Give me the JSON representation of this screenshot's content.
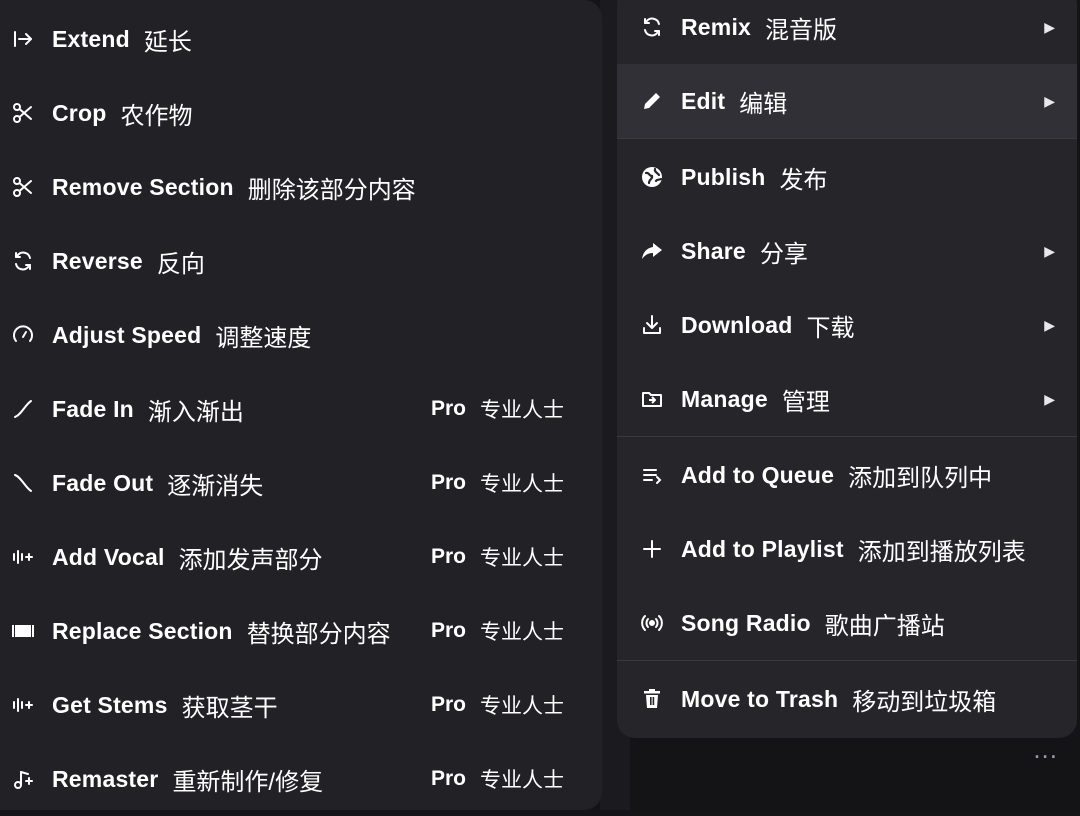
{
  "edit_submenu": {
    "items": [
      {
        "label": "Extend",
        "cn": "延长",
        "icon": "extend-icon",
        "pro": false
      },
      {
        "label": "Crop",
        "cn": "农作物",
        "icon": "scissors-icon",
        "pro": false
      },
      {
        "label": "Remove Section",
        "cn": "删除该部分内容",
        "icon": "scissors-icon",
        "pro": false
      },
      {
        "label": "Reverse",
        "cn": "反向",
        "icon": "reverse-icon",
        "pro": false
      },
      {
        "label": "Adjust Speed",
        "cn": "调整速度",
        "icon": "speed-icon",
        "pro": false
      },
      {
        "label": "Fade In",
        "cn": "渐入渐出",
        "icon": "fade-in-icon",
        "pro": true
      },
      {
        "label": "Fade Out",
        "cn": "逐渐消失",
        "icon": "fade-out-icon",
        "pro": true
      },
      {
        "label": "Add Vocal",
        "cn": "添加发声部分",
        "icon": "waveform-add-icon",
        "pro": true
      },
      {
        "label": "Replace Section",
        "cn": "替换部分内容",
        "icon": "replace-section-icon",
        "pro": true
      },
      {
        "label": "Get Stems",
        "cn": "获取茎干",
        "icon": "waveform-add-icon",
        "pro": true
      },
      {
        "label": "Remaster",
        "cn": "重新制作/修复",
        "icon": "music-note-sparkle-icon",
        "pro": true
      }
    ],
    "pro_label": "Pro",
    "pro_cn": "专业人士"
  },
  "context_menu": {
    "items": [
      {
        "label": "Remix",
        "cn": "混音版",
        "icon": "remix-icon",
        "submenu": true
      },
      {
        "label": "Edit",
        "cn": "编辑",
        "icon": "pencil-icon",
        "submenu": true,
        "active": true
      },
      {
        "label": "Publish",
        "cn": "发布",
        "icon": "globe-icon",
        "submenu": false
      },
      {
        "label": "Share",
        "cn": "分享",
        "icon": "share-arrow-icon",
        "submenu": true
      },
      {
        "label": "Download",
        "cn": "下载",
        "icon": "download-icon",
        "submenu": true
      },
      {
        "label": "Manage",
        "cn": "管理",
        "icon": "folder-icon",
        "submenu": true
      },
      {
        "label": "Add to Queue",
        "cn": "添加到队列中",
        "icon": "queue-icon",
        "submenu": false
      },
      {
        "label": "Add to Playlist",
        "cn": "添加到播放列表",
        "icon": "plus-icon",
        "submenu": false
      },
      {
        "label": "Song Radio",
        "cn": "歌曲广播站",
        "icon": "radio-icon",
        "submenu": false
      },
      {
        "label": "Move to Trash",
        "cn": "移动到垃圾箱",
        "icon": "trash-icon",
        "submenu": false
      }
    ]
  },
  "background": {
    "more_label": "..."
  },
  "colors": {
    "menu_bg": "#222226",
    "active_bg": "#303036",
    "text": "#ffffff"
  }
}
